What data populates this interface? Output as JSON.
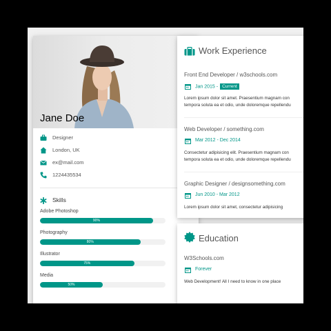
{
  "colors": {
    "accent": "#009688",
    "background": "#f1f1f1",
    "card": "#ffffff"
  },
  "profile": {
    "name": "Jane Doe",
    "info": [
      {
        "icon": "briefcase-icon",
        "text": "Designer"
      },
      {
        "icon": "home-icon",
        "text": "London, UK"
      },
      {
        "icon": "envelope-icon",
        "text": "ex@mail.com"
      },
      {
        "icon": "phone-icon",
        "text": "1224435534"
      }
    ]
  },
  "skills": {
    "title": "Skills",
    "icon": "asterisk-icon",
    "items": [
      {
        "label": "Adobe Photoshop",
        "percent": 90,
        "text": "90%"
      },
      {
        "label": "Photography",
        "percent": 80,
        "text": "80%"
      },
      {
        "label": "Illustrator",
        "percent": 75,
        "text": "75%"
      },
      {
        "label": "Media",
        "percent": 50,
        "text": "50%"
      }
    ]
  },
  "work": {
    "title": "Work Experience",
    "icon": "suitcase-icon",
    "entries": [
      {
        "title": "Front End Developer / w3schools.com",
        "date": "Jan 2015 -",
        "badge": "Current",
        "body1": "Lorem ipsum dolor sit amet. Praesentium magnam con",
        "body2": "tempora soluta ea et odio, unde doloremque repellendu"
      },
      {
        "title": "Web Developer / something.com",
        "date": "Mar 2012 - Dec 2014",
        "badge": "",
        "body1": "Consectetur adipisicing elit. Praesentium magnam con",
        "body2": "tempora soluta ea et odio, unde doloremque repellendu"
      },
      {
        "title": "Graphic Designer / designsomething.com",
        "date": "Jun 2010 - Mar 2012",
        "badge": "",
        "body1": "Lorem ipsum dolor sit amet, consectetur adipisicing",
        "body2": ""
      }
    ]
  },
  "education": {
    "title": "Education",
    "icon": "certificate-icon",
    "entries": [
      {
        "title": "W3Schools.com",
        "date": "Forever",
        "body1": "Web Development! All I need to know in one place"
      }
    ]
  }
}
